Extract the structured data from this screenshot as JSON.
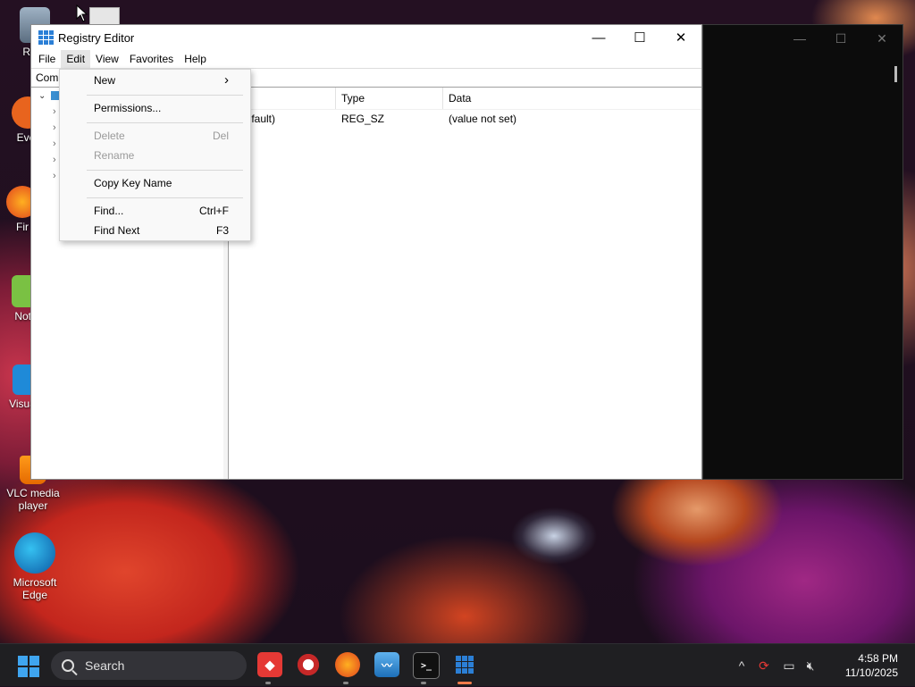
{
  "desktop": {
    "icons": [
      {
        "label": "Recy",
        "name": "recycle-bin"
      },
      {
        "label": "Ever",
        "name": "everything"
      },
      {
        "label": "Fir",
        "name": "firefox"
      },
      {
        "label": "Note",
        "name": "notepad-plus"
      },
      {
        "label": "Visua C",
        "name": "visual-studio-code"
      },
      {
        "label": "VLC media player",
        "name": "vlc"
      },
      {
        "label": "Microsoft Edge",
        "name": "microsoft-edge"
      }
    ]
  },
  "window": {
    "title": "Registry Editor",
    "minimize": "—",
    "maximize": "☐",
    "close": "✕"
  },
  "menubar": {
    "file": "File",
    "edit": "Edit",
    "view": "View",
    "favorites": "Favorites",
    "help": "Help"
  },
  "address": {
    "text": "Com"
  },
  "list": {
    "headers": {
      "name": "ne",
      "type": "Type",
      "data": "Data"
    },
    "rows": [
      {
        "name": "(Default)",
        "type": "REG_SZ",
        "data": "(value not set)"
      }
    ]
  },
  "edit_menu": {
    "new": "New",
    "new_arrow": "›",
    "permissions": "Permissions...",
    "delete": "Delete",
    "delete_shortcut": "Del",
    "rename": "Rename",
    "copy_key_name": "Copy Key Name",
    "find": "Find...",
    "find_shortcut": "Ctrl+F",
    "find_next": "Find Next",
    "find_next_shortcut": "F3"
  },
  "taskbar": {
    "search_placeholder": "Search",
    "time": "4:58 PM",
    "date": "11/10/2025",
    "chevron": "^"
  },
  "colors": {
    "accent": "#3fa5f0",
    "taskbar_bg": "#1f1f22",
    "active_indicator": "#f07c4b"
  }
}
